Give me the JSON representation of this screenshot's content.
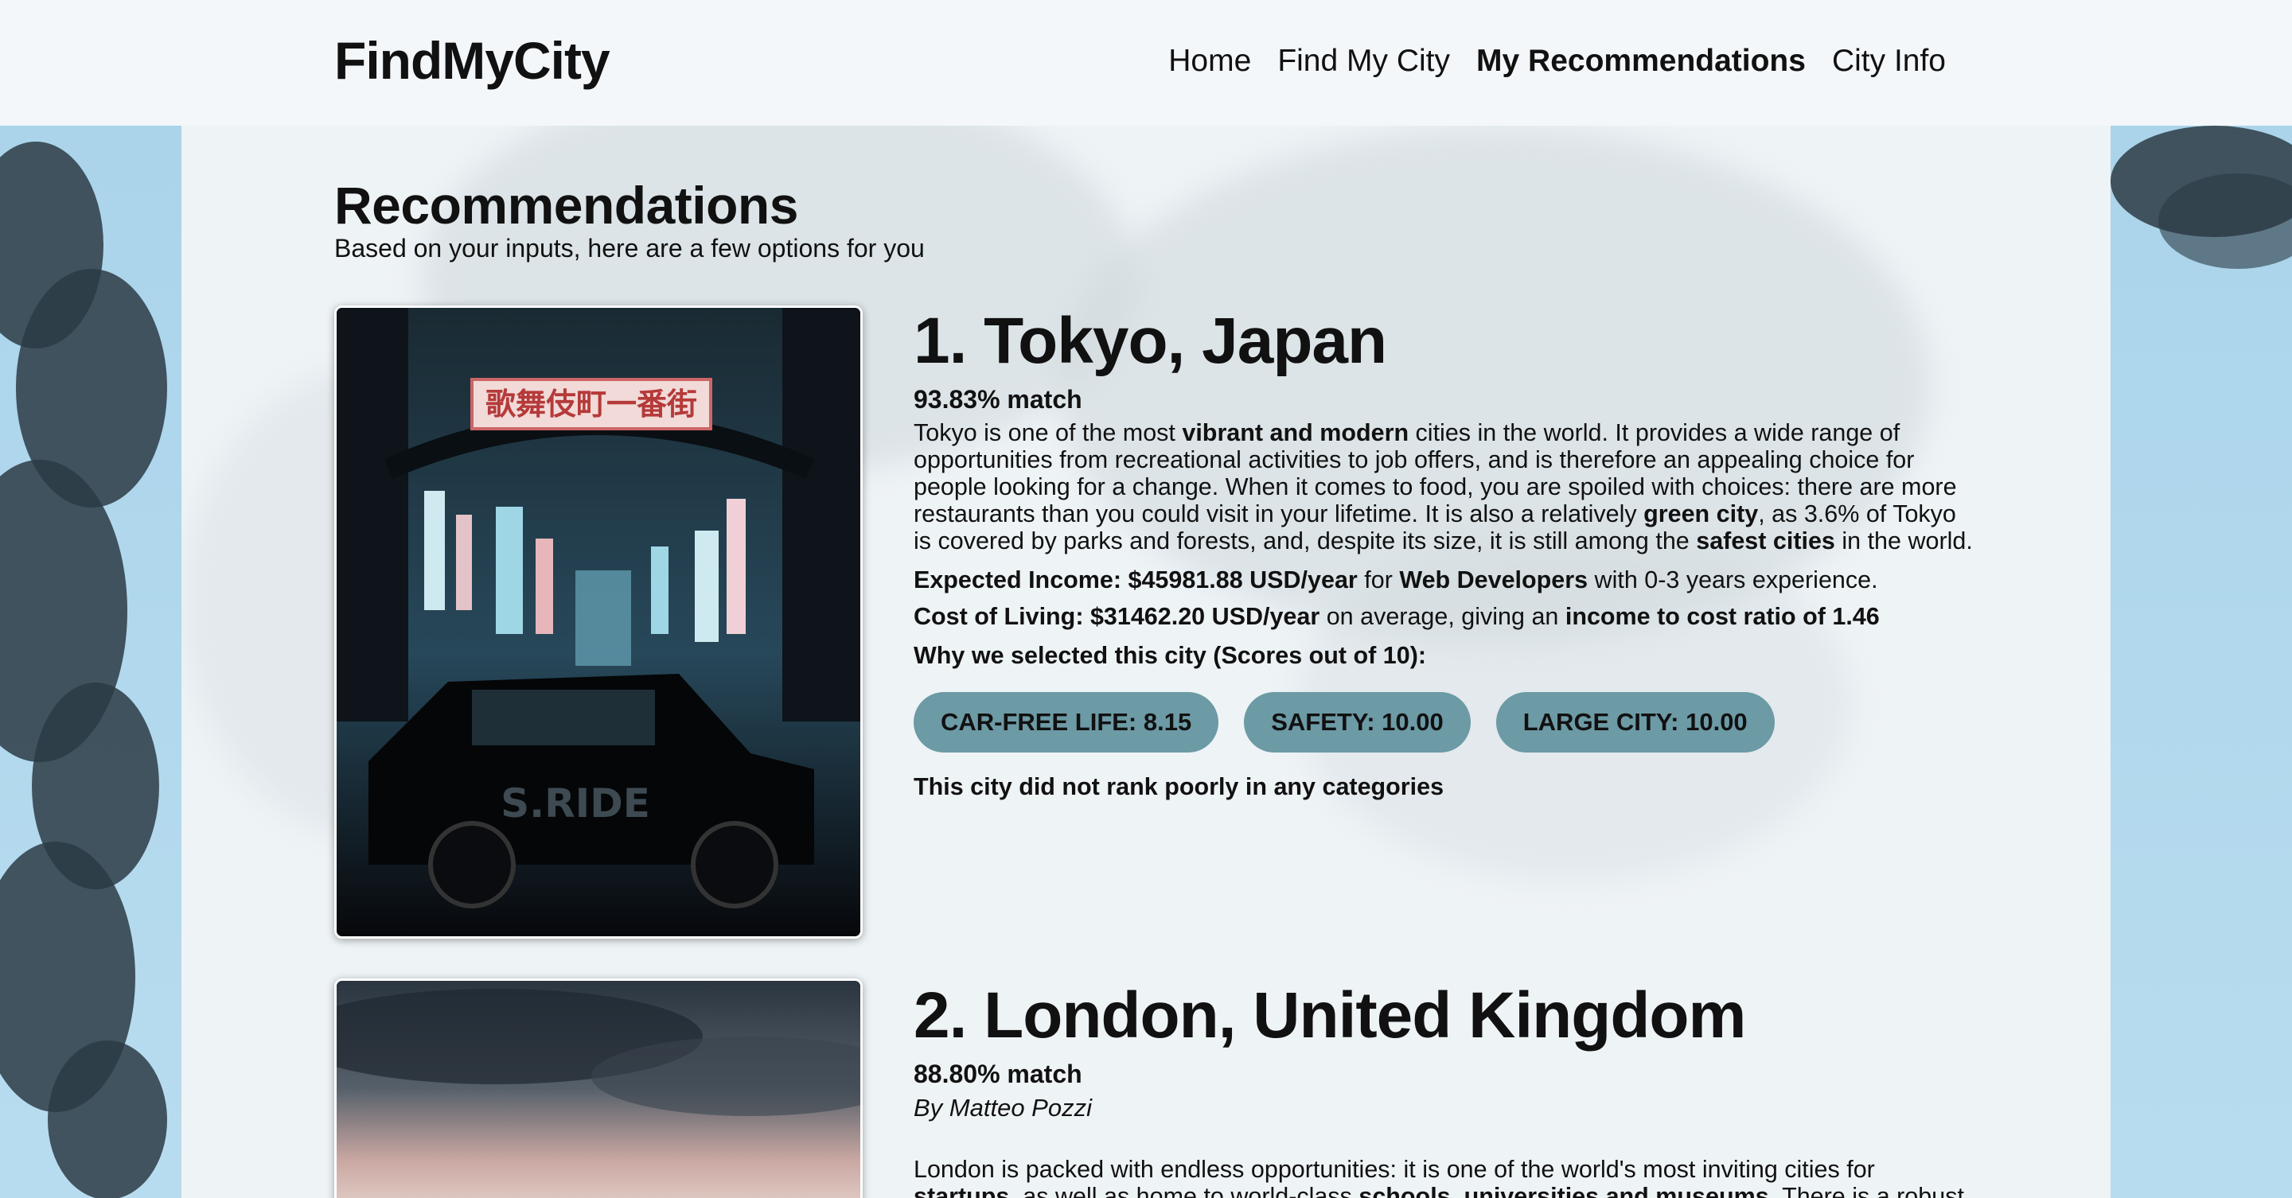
{
  "header": {
    "brand": "FindMyCity",
    "nav": [
      "Home",
      "Find My City",
      "My Recommendations",
      "City Info"
    ],
    "active_nav": "My Recommendations"
  },
  "page": {
    "title": "Recommendations",
    "subtitle": "Based on your inputs, here are a few options for you"
  },
  "cities": [
    {
      "title": "1. Tokyo, Japan",
      "match": "93.83% match",
      "image_sign": "歌舞伎町一番街",
      "image_car_text": "S.RIDE",
      "desc": {
        "p1": "Tokyo is one of the most ",
        "b1": "vibrant and modern",
        "p2": " cities in the world. It provides a wide range of opportunities from recreational activities to job offers, and is therefore an appealing choice for people looking for a change. When it comes to food, you are spoiled with choices: there are more restaurants than you could visit in your lifetime. It is also a relatively ",
        "b2": "green city",
        "p3": ", as 3.6% of Tokyo is covered by parks and forests, and, despite its size, it is still among the ",
        "b3": "safest cities",
        "p4": " in the world."
      },
      "income": {
        "label": "Expected Income: $45981.88 USD/year",
        "mid": " for ",
        "job": "Web Developers",
        "tail": " with 0-3 years experience."
      },
      "cost": {
        "label": "Cost of Living: $31462.20 USD/year",
        "mid": " on average, giving an ",
        "ratio": "income to cost ratio of 1.46"
      },
      "why": "Why we selected this city (Scores out of 10):",
      "scores": [
        "CAR-FREE LIFE: 8.15",
        "SAFETY: 10.00",
        "LARGE CITY: 10.00"
      ],
      "poor": "This city did not rank poorly in any categories"
    },
    {
      "title": "2. London, United Kingdom",
      "match": "88.80% match",
      "byline": "By Matteo Pozzi",
      "desc": {
        "p1": "London is packed with endless opportunities: it is one of the world's most inviting cities for ",
        "b1": "startups",
        "p2": ", as well as home to world-class ",
        "b2": "schools, universities and museums",
        "p3": ". There is a robust"
      }
    }
  ]
}
